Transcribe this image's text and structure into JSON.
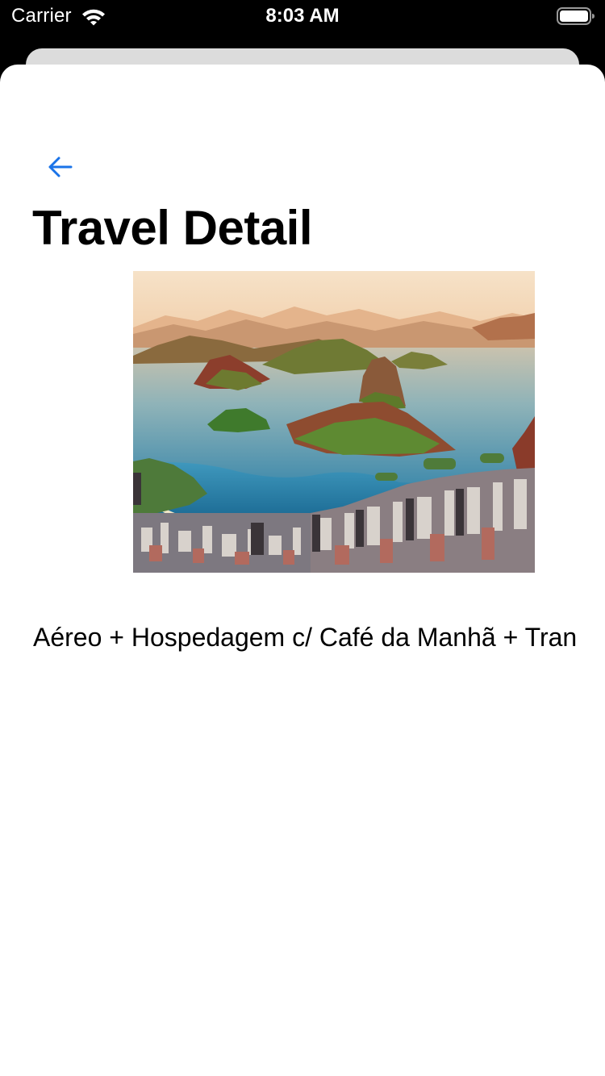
{
  "status_bar": {
    "carrier": "Carrier",
    "time": "8:03 AM",
    "wifi_icon": "wifi-icon",
    "battery_icon": "battery-icon"
  },
  "navigation": {
    "back_icon": "back-arrow-icon",
    "accent_color": "#1a73e8"
  },
  "page": {
    "title": "Travel Detail",
    "image_subject": "rio-de-janeiro-bay-photo",
    "description": "Aéreo + Hospedagem c/ Café da Manhã + Tran"
  }
}
